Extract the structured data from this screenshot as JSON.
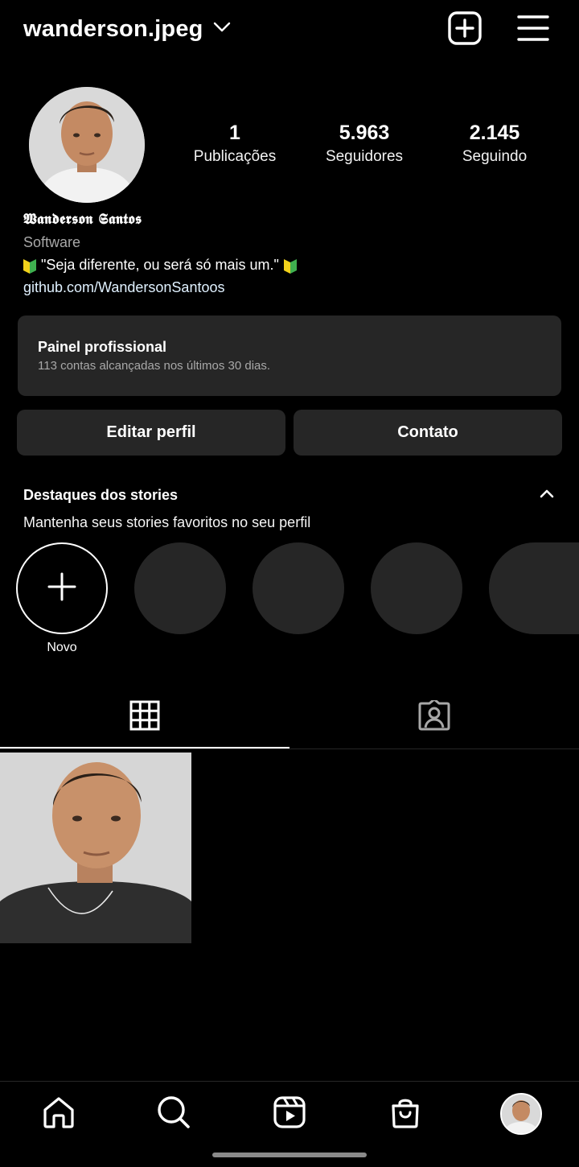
{
  "header": {
    "username": "wanderson.jpeg"
  },
  "profile": {
    "stats": [
      {
        "value": "1",
        "label": "Publicações"
      },
      {
        "value": "5.963",
        "label": "Seguidores"
      },
      {
        "value": "2.145",
        "label": "Seguindo"
      }
    ],
    "full_name": "𝖂𝖆𝖓𝖉𝖊𝖗𝖘𝖔𝖓 𝕾𝖆𝖓𝖙𝖔𝖘",
    "category": "Software",
    "bio_quote": "\"Seja diferente, ou será só mais um.\"",
    "link": "github.com/WandersonSantoos"
  },
  "professional_panel": {
    "title": "Painel profissional",
    "subtitle": "113 contas alcançadas nos últimos 30 dias."
  },
  "actions": {
    "edit_label": "Editar perfil",
    "contact_label": "Contato"
  },
  "highlights": {
    "title": "Destaques dos stories",
    "subtitle": "Mantenha seus stories favoritos no seu perfil",
    "new_label": "Novo"
  },
  "colors": {
    "background": "#000000",
    "surface": "#262626",
    "secondary_text": "#a8a8a8",
    "link": "#e0f1ff",
    "badge_green": "#3fb04f",
    "badge_yellow": "#f2d21b"
  },
  "icons": {
    "dropdown": "chevron-down-icon",
    "new_post": "plus-square-icon",
    "menu": "hamburger-menu-icon",
    "add_highlight": "plus-icon",
    "grid_tab": "grid-icon",
    "tagged_tab": "tagged-person-icon",
    "nav_home": "home-icon",
    "nav_search": "search-icon",
    "nav_reels": "reels-icon",
    "nav_shop": "shopping-bag-icon"
  }
}
